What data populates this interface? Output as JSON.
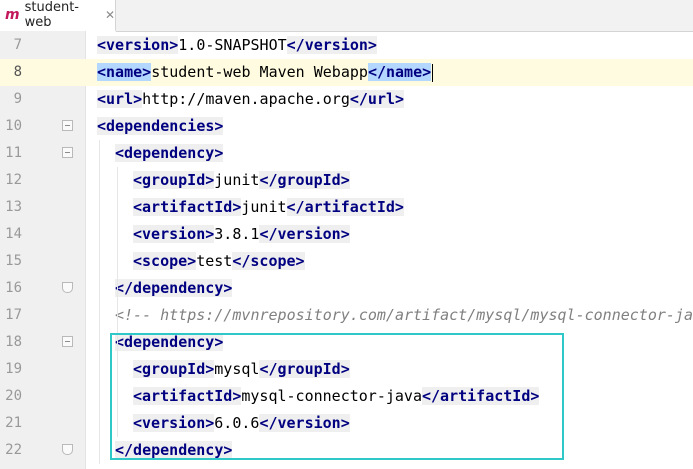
{
  "tab": {
    "icon": "maven-icon",
    "icon_glyph": "m",
    "label": "student-web",
    "close_glyph": "✕"
  },
  "lines": [
    {
      "num": "7",
      "fold": "",
      "indent": 0,
      "tokens": [
        [
          "tag",
          "<version>"
        ],
        [
          "txt",
          "1.0-SNAPSHOT"
        ],
        [
          "tag",
          "</version>"
        ]
      ]
    },
    {
      "num": "8",
      "fold": "",
      "indent": 0,
      "current": true,
      "tokens": [
        [
          "taghl",
          "<name>"
        ],
        [
          "txt",
          "student-web Maven Webapp"
        ],
        [
          "taghl",
          "</name>"
        ],
        [
          "caret",
          ""
        ]
      ]
    },
    {
      "num": "9",
      "fold": "",
      "indent": 0,
      "tokens": [
        [
          "tag",
          "<url>"
        ],
        [
          "txt",
          "http://maven.apache.org"
        ],
        [
          "tag",
          "</url>"
        ]
      ]
    },
    {
      "num": "10",
      "fold": "open",
      "indent": 0,
      "tokens": [
        [
          "tag",
          "<dependencies>"
        ]
      ]
    },
    {
      "num": "11",
      "fold": "open",
      "indent": 1,
      "tokens": [
        [
          "tag",
          "<dependency>"
        ]
      ]
    },
    {
      "num": "12",
      "fold": "",
      "indent": 2,
      "tokens": [
        [
          "tag",
          "<groupId>"
        ],
        [
          "txt",
          "junit"
        ],
        [
          "tag",
          "</groupId>"
        ]
      ]
    },
    {
      "num": "13",
      "fold": "",
      "indent": 2,
      "tokens": [
        [
          "tag",
          "<artifactId>"
        ],
        [
          "txt",
          "junit"
        ],
        [
          "tag",
          "</artifactId>"
        ]
      ]
    },
    {
      "num": "14",
      "fold": "",
      "indent": 2,
      "tokens": [
        [
          "tag",
          "<version>"
        ],
        [
          "txt",
          "3.8.1"
        ],
        [
          "tag",
          "</version>"
        ]
      ]
    },
    {
      "num": "15",
      "fold": "",
      "indent": 2,
      "tokens": [
        [
          "tag",
          "<scope>"
        ],
        [
          "txt",
          "test"
        ],
        [
          "tag",
          "</scope>"
        ]
      ]
    },
    {
      "num": "16",
      "fold": "end",
      "indent": 1,
      "tokens": [
        [
          "tag",
          "</dependency>"
        ]
      ]
    },
    {
      "num": "17",
      "fold": "",
      "indent": 1,
      "tokens": [
        [
          "comment",
          "<!-- https://mvnrepository.com/artifact/mysql/mysql-connector-ja"
        ]
      ]
    },
    {
      "num": "18",
      "fold": "open",
      "indent": 1,
      "tokens": [
        [
          "tag",
          "<dependency>"
        ]
      ]
    },
    {
      "num": "19",
      "fold": "",
      "indent": 2,
      "tokens": [
        [
          "tag",
          "<groupId>"
        ],
        [
          "txt",
          "mysql"
        ],
        [
          "tag",
          "</groupId>"
        ]
      ]
    },
    {
      "num": "20",
      "fold": "",
      "indent": 2,
      "tokens": [
        [
          "tag",
          "<artifactId>"
        ],
        [
          "txt",
          "mysql-connector-java"
        ],
        [
          "tag",
          "</artifactId>"
        ]
      ]
    },
    {
      "num": "21",
      "fold": "",
      "indent": 2,
      "tokens": [
        [
          "tag",
          "<version>"
        ],
        [
          "txt",
          "6.0.6"
        ],
        [
          "tag",
          "</version>"
        ]
      ]
    },
    {
      "num": "22",
      "fold": "end",
      "indent": 1,
      "tokens": [
        [
          "tag",
          "</dependency>"
        ]
      ]
    }
  ],
  "colors": {
    "highlight_box": "#2ec8c8",
    "tag": "#000080",
    "current_line": "#fffbe0"
  }
}
